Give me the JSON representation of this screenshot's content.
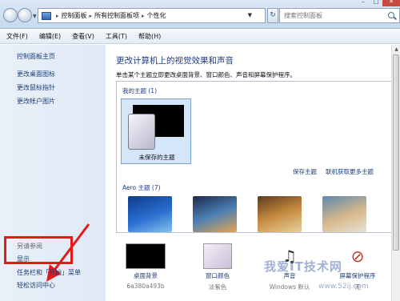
{
  "addressbar": {
    "breadcrumbs": [
      "控制面板",
      "所有控制面板项",
      "个性化"
    ],
    "search_placeholder": "搜索控制面板"
  },
  "menubar": {
    "items": [
      "文件(F)",
      "编辑(E)",
      "查看(V)",
      "工具(T)",
      "帮助(H)"
    ]
  },
  "sidebar": {
    "home_link": "控制面板主页",
    "links": [
      "更改桌面图标",
      "更改鼠标指针",
      "更改帐户图片"
    ],
    "see_also_title": "另请参阅",
    "see_also_links": [
      "显示",
      "任务栏和「开始」菜单",
      "轻松访问中心"
    ]
  },
  "main": {
    "heading": "更改计算机上的视觉效果和声音",
    "description": "单击某个主题立即更改桌面背景、窗口颜色、声音和屏幕保护程序。",
    "my_themes_title": "我的主题 (1)",
    "unsaved_theme_label": "未保存的主题",
    "save_theme_link": "保存主题",
    "get_more_link": "联机获取更多主题",
    "aero_title": "Aero 主题 (7)"
  },
  "bottom_settings": [
    {
      "label": "桌面背景",
      "sub": "6a380a493b"
    },
    {
      "label": "窗口颜色",
      "sub": "淡紫色"
    },
    {
      "label": "声音",
      "sub": "Windows 默认"
    },
    {
      "label": "屏幕保护程序",
      "sub": "无"
    }
  ],
  "watermark": {
    "text": "我爱IT技术网",
    "url": "www.52ij.com"
  },
  "colors": {
    "highlight_red": "#e21a1a",
    "link_blue": "#1c3d78",
    "heading_blue": "#1f3b8a"
  }
}
